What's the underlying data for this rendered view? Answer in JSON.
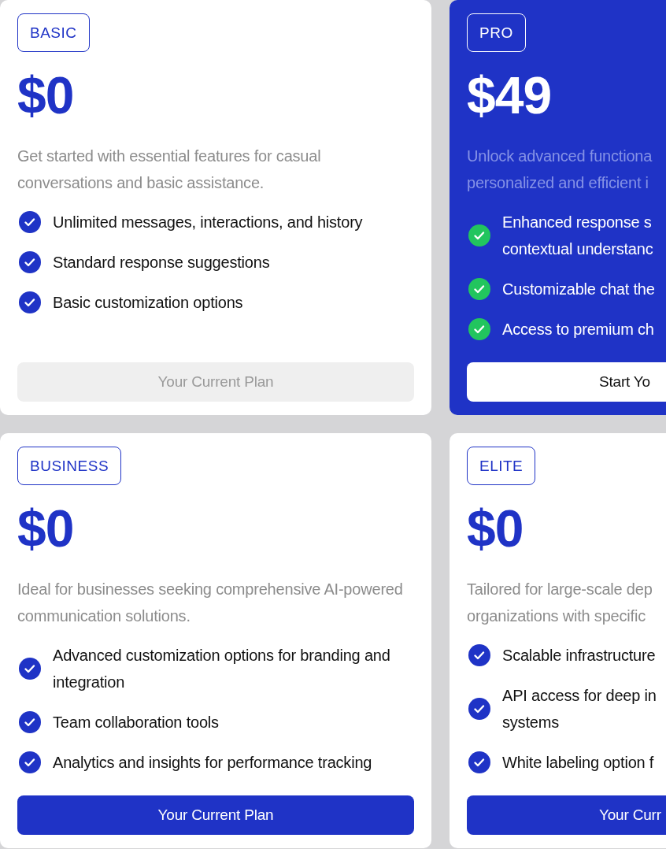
{
  "plans": [
    {
      "name": "BASIC",
      "price": "$0",
      "highlighted": false,
      "description": "Get started with essential features for casual conversations and basic assistance.",
      "features": [
        "Unlimited messages, interactions, and history",
        "Standard response suggestions",
        "Basic customization options"
      ],
      "button": {
        "label": "Your Current Plan",
        "kind": "disabled"
      }
    },
    {
      "name": "PRO",
      "price": "$49",
      "highlighted": true,
      "description": "Unlock advanced functiona\npersonalized and efficient i",
      "features": [
        "Enhanced response s\ncontextual understanc",
        "Customizable chat the",
        "Access to premium ch"
      ],
      "button": {
        "label": "Start Yo",
        "kind": "inverse"
      }
    },
    {
      "name": "BUSINESS",
      "price": "$0",
      "highlighted": false,
      "description": "Ideal for businesses seeking comprehensive AI-powered communication solutions.",
      "features": [
        "Advanced customization options for branding and integration",
        "Team collaboration tools",
        "Analytics and insights for performance tracking"
      ],
      "button": {
        "label": "Your Current Plan",
        "kind": "primary"
      }
    },
    {
      "name": "ELITE",
      "price": "$0",
      "highlighted": false,
      "description": "Tailored for large-scale dep\norganizations with specific",
      "features": [
        "Scalable infrastructure",
        "API access for deep in\nsystems",
        "White labeling option f"
      ],
      "button": {
        "label": "Your Curr",
        "kind": "primary"
      }
    }
  ]
}
